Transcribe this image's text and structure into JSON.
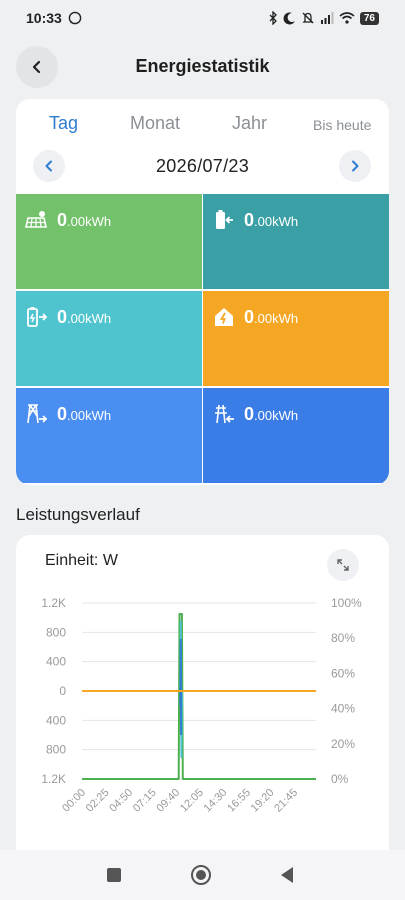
{
  "status_bar": {
    "time": "10:33",
    "battery": "76"
  },
  "header": {
    "title": "Energiestatistik"
  },
  "tabs": [
    {
      "label": "Tag",
      "active": true
    },
    {
      "label": "Monat",
      "active": false
    },
    {
      "label": "Jahr",
      "active": false
    },
    {
      "label": "Bis heute",
      "active": false
    }
  ],
  "date": "2026/07/23",
  "tiles": [
    {
      "icon": "solar-panel-icon",
      "value": "0",
      "unit": ".00kWh",
      "color": "#73c16b"
    },
    {
      "icon": "battery-charge-icon",
      "value": "0",
      "unit": ".00kWh",
      "color": "#3aa0a5"
    },
    {
      "icon": "battery-discharge-icon",
      "value": "0",
      "unit": ".00kWh",
      "color": "#4fc4cf"
    },
    {
      "icon": "home-consumption-icon",
      "value": "0",
      "unit": ".00kWh",
      "color": "#f5a623"
    },
    {
      "icon": "grid-export-icon",
      "value": "0",
      "unit": ".00kWh",
      "color": "#4b8ef2"
    },
    {
      "icon": "grid-import-icon",
      "value": "0",
      "unit": ".00kWh",
      "color": "#3b7de6"
    }
  ],
  "section": {
    "title": "Leistungsverlauf"
  },
  "chart_card": {
    "unit_label": "Einheit: W"
  },
  "chart_data": {
    "type": "line",
    "y_left_ticks": [
      "1.2K",
      "800",
      "400",
      "0",
      "400",
      "800",
      "1.2K"
    ],
    "y_right_ticks": [
      "100%",
      "80%",
      "60%",
      "40%",
      "20%",
      "0%"
    ],
    "x_ticks": [
      "00:00",
      "02:25",
      "04:50",
      "07:15",
      "09:40",
      "12:05",
      "14:30",
      "16:55",
      "19:20",
      "21:45"
    ],
    "ylim": [
      -1200,
      1200
    ],
    "y_right_lim": [
      0,
      100
    ],
    "grid": true,
    "series": [
      {
        "color": "#4caf50",
        "points": [
          [
            "00:00",
            -1200
          ],
          [
            "09:55",
            -1200
          ],
          [
            "10:00",
            1050
          ],
          [
            "10:15",
            1050
          ],
          [
            "10:20",
            -1200
          ],
          [
            "24:00",
            -1200
          ]
        ]
      },
      {
        "color": "#4fc4cf",
        "points": [
          [
            "00:00",
            0
          ],
          [
            "10:05",
            0
          ],
          [
            "10:08",
            950
          ],
          [
            "10:12",
            -900
          ],
          [
            "10:15",
            0
          ],
          [
            "24:00",
            0
          ]
        ]
      },
      {
        "color": "#2f7dd1",
        "points": [
          [
            "10:05",
            -200
          ],
          [
            "10:08",
            700
          ],
          [
            "10:10",
            -600
          ]
        ]
      },
      {
        "color": "#f5a623",
        "points": [
          [
            "00:00",
            0
          ],
          [
            "24:00",
            0
          ]
        ]
      }
    ]
  },
  "colors": {
    "accent": "#2f7dd1",
    "tab_inactive": "#8b8f96"
  }
}
